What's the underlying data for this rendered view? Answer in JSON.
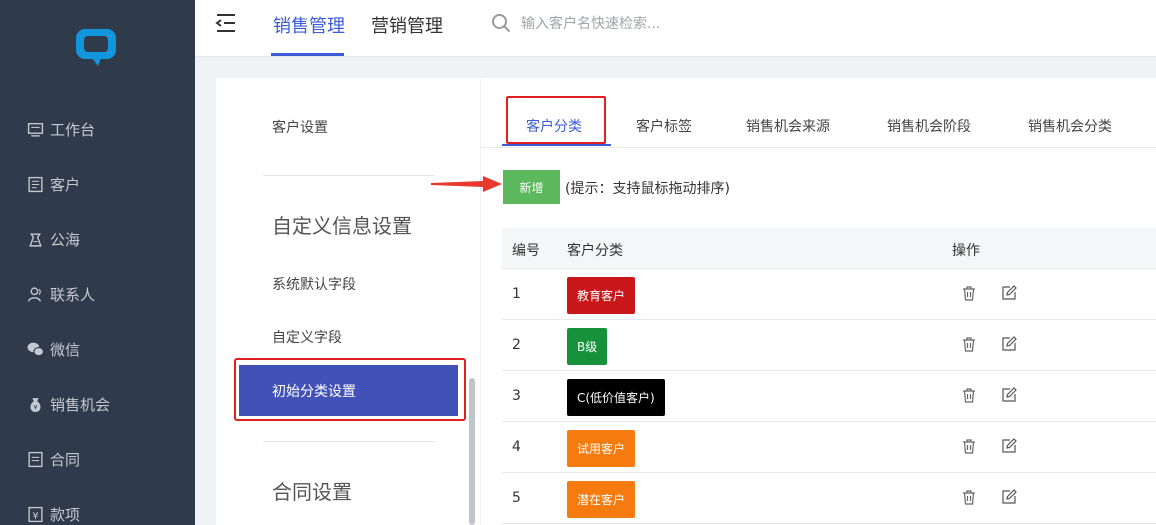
{
  "sidebar": {
    "items": [
      {
        "label": "工作台",
        "icon": "monitor-icon"
      },
      {
        "label": "客户",
        "icon": "customer-icon"
      },
      {
        "label": "公海",
        "icon": "sea-icon"
      },
      {
        "label": "联系人",
        "icon": "contact-icon"
      },
      {
        "label": "微信",
        "icon": "wechat-icon"
      },
      {
        "label": "销售机会",
        "icon": "money-bag-icon"
      },
      {
        "label": "合同",
        "icon": "contract-icon"
      },
      {
        "label": "款项",
        "icon": "yen-icon"
      }
    ]
  },
  "topbar": {
    "tabs": [
      {
        "label": "销售管理",
        "active": true
      },
      {
        "label": "营销管理",
        "active": false
      }
    ],
    "search_placeholder": "输入客户名快速检索..."
  },
  "left_panel": {
    "customer_settings": "客户设置",
    "custom_info_heading": "自定义信息设置",
    "system_default_fields": "系统默认字段",
    "custom_fields": "自定义字段",
    "initial_category_settings": "初始分类设置",
    "contract_settings_heading": "合同设置"
  },
  "content_tabs": [
    {
      "label": "客户分类",
      "active": true
    },
    {
      "label": "客户标签",
      "active": false
    },
    {
      "label": "销售机会来源",
      "active": false
    },
    {
      "label": "销售机会阶段",
      "active": false
    },
    {
      "label": "销售机会分类",
      "active": false
    }
  ],
  "toolbar": {
    "add_label": "新增",
    "hint": "(提示：支持鼠标拖动排序)"
  },
  "table": {
    "headers": {
      "num": "编号",
      "category": "客户分类",
      "actions": "操作"
    },
    "rows": [
      {
        "num": "1",
        "category": "教育客户",
        "color": "#c9161b"
      },
      {
        "num": "2",
        "category": "B级",
        "color": "#17923a"
      },
      {
        "num": "3",
        "category": "C(低价值客户)",
        "color": "#000000"
      },
      {
        "num": "4",
        "category": "试用客户",
        "color": "#f57b0f"
      },
      {
        "num": "5",
        "category": "潜在客户",
        "color": "#f57b0f"
      }
    ]
  },
  "colors": {
    "sidebar_bg": "#2f3b4a",
    "accent": "#3b5bd8",
    "active_item_bg": "#4151b8",
    "add_button": "#5cb85c",
    "annotation_red": "#e02020"
  }
}
